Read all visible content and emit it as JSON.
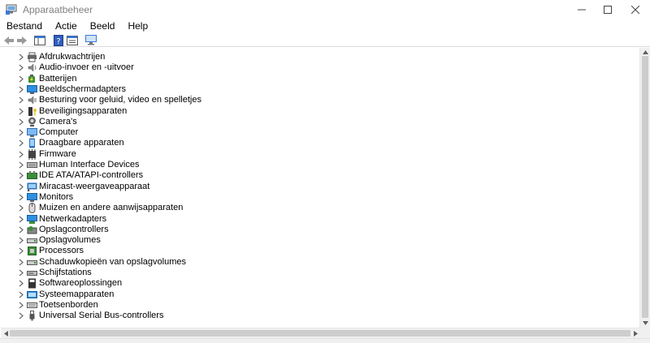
{
  "window": {
    "title": "Apparaatbeheer"
  },
  "menu": [
    "Bestand",
    "Actie",
    "Beeld",
    "Help"
  ],
  "toolbar": {
    "buttons": [
      "back-icon",
      "forward-icon",
      "show-hide-console-tree-icon",
      "help-icon",
      "properties-icon",
      "scan-hardware-icon"
    ]
  },
  "tree": {
    "items": [
      {
        "label": "Afdrukwachtrijen",
        "icon": "printer-icon"
      },
      {
        "label": "Audio-invoer en -uitvoer",
        "icon": "speaker-icon"
      },
      {
        "label": "Batterijen",
        "icon": "battery-icon"
      },
      {
        "label": "Beeldschermadapters",
        "icon": "display-adapter-icon"
      },
      {
        "label": "Besturing voor geluid, video en spelletjes",
        "icon": "sound-icon"
      },
      {
        "label": "Beveiligingsapparaten",
        "icon": "security-key-icon"
      },
      {
        "label": "Camera's",
        "icon": "camera-icon"
      },
      {
        "label": "Computer",
        "icon": "computer-icon"
      },
      {
        "label": "Draagbare apparaten",
        "icon": "portable-device-icon"
      },
      {
        "label": "Firmware",
        "icon": "firmware-icon"
      },
      {
        "label": "Human Interface Devices",
        "icon": "keyboard-device-icon"
      },
      {
        "label": "IDE ATA/ATAPI-controllers",
        "icon": "controller-icon"
      },
      {
        "label": "Miracast-weergaveapparaat",
        "icon": "miracast-icon"
      },
      {
        "label": "Monitors",
        "icon": "monitor-icon"
      },
      {
        "label": "Muizen en andere aanwijsapparaten",
        "icon": "mouse-icon"
      },
      {
        "label": "Netwerkadapters",
        "icon": "network-icon"
      },
      {
        "label": "Opslagcontrollers",
        "icon": "storage-controller-icon"
      },
      {
        "label": "Opslagvolumes",
        "icon": "drive-icon"
      },
      {
        "label": "Processors",
        "icon": "processor-icon"
      },
      {
        "label": "Schaduwkopieën van opslagvolumes",
        "icon": "drive-icon"
      },
      {
        "label": "Schijfstations",
        "icon": "disk-icon"
      },
      {
        "label": "Softwareoplossingen",
        "icon": "software-icon"
      },
      {
        "label": "Systeemapparaten",
        "icon": "system-device-icon"
      },
      {
        "label": "Toetsenborden",
        "icon": "keyboard-icon"
      },
      {
        "label": "Universal Serial Bus-controllers",
        "icon": "usb-icon"
      }
    ]
  },
  "colors": {
    "monitor_blue": "#2f8fe0",
    "scroll_track": "#f0f0f0",
    "scroll_thumb": "#cdcdcd"
  }
}
